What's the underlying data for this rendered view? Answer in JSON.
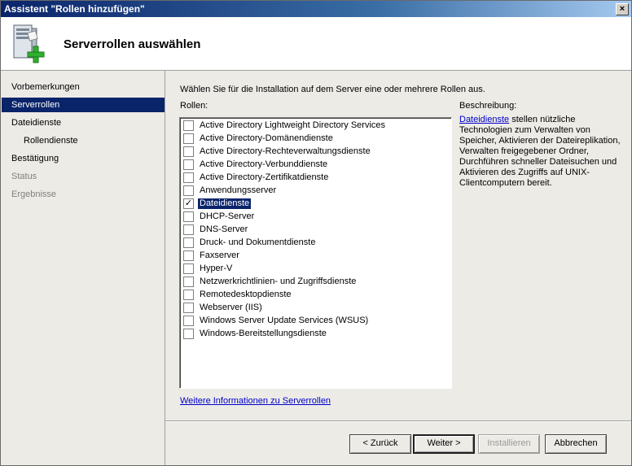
{
  "window": {
    "title": "Assistent \"Rollen hinzufügen\"",
    "close_glyph": "×"
  },
  "header": {
    "title": "Serverrollen auswählen",
    "icon": "server-add-icon"
  },
  "sidebar": {
    "items": [
      {
        "label": "Vorbemerkungen",
        "state": "normal"
      },
      {
        "label": "Serverrollen",
        "state": "active"
      },
      {
        "label": "Dateidienste",
        "state": "normal"
      },
      {
        "label": "Rollendienste",
        "state": "sub"
      },
      {
        "label": "Bestätigung",
        "state": "normal"
      },
      {
        "label": "Status",
        "state": "disabled"
      },
      {
        "label": "Ergebnisse",
        "state": "disabled"
      }
    ]
  },
  "main": {
    "instruction": "Wählen Sie für die Installation auf dem Server eine oder mehrere Rollen aus.",
    "roles_label": "Rollen:",
    "description_label": "Beschreibung:",
    "roles": [
      {
        "label": "Active Directory Lightweight Directory Services",
        "checked": false
      },
      {
        "label": "Active Directory-Domänendienste",
        "checked": false
      },
      {
        "label": "Active Directory-Rechteverwaltungsdienste",
        "checked": false
      },
      {
        "label": "Active Directory-Verbunddienste",
        "checked": false
      },
      {
        "label": "Active Directory-Zertifikatdienste",
        "checked": false
      },
      {
        "label": "Anwendungsserver",
        "checked": false
      },
      {
        "label": "Dateidienste",
        "checked": true,
        "selected": true
      },
      {
        "label": "DHCP-Server",
        "checked": false
      },
      {
        "label": "DNS-Server",
        "checked": false
      },
      {
        "label": "Druck- und Dokumentdienste",
        "checked": false
      },
      {
        "label": "Faxserver",
        "checked": false
      },
      {
        "label": "Hyper-V",
        "checked": false
      },
      {
        "label": "Netzwerkrichtlinien- und Zugriffsdienste",
        "checked": false
      },
      {
        "label": "Remotedesktopdienste",
        "checked": false
      },
      {
        "label": "Webserver (IIS)",
        "checked": false
      },
      {
        "label": "Windows Server Update Services (WSUS)",
        "checked": false
      },
      {
        "label": "Windows-Bereitstellungsdienste",
        "checked": false
      }
    ],
    "description": {
      "link_text": "Dateidienste",
      "text": " stellen nützliche Technologien zum Verwalten von Speicher, Aktivieren der Dateireplikation, Verwalten freigegebener Ordner, Durchführen schneller Dateisuchen und Aktivieren des Zugriffs auf UNIX-Clientcomputern bereit."
    },
    "more_info_link": "Weitere Informationen zu Serverrollen"
  },
  "buttons": {
    "back": "< Zurück",
    "next": "Weiter >",
    "install": "Installieren",
    "cancel": "Abbrechen"
  },
  "colors": {
    "accent": "#0a246a",
    "link": "#0000cc"
  }
}
